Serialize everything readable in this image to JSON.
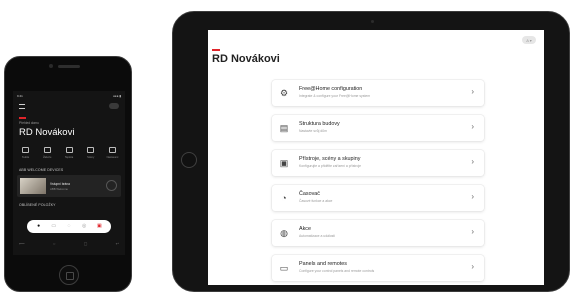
{
  "phone": {
    "status_time": "9:41",
    "status_right": "●●● ▮",
    "subtitle": "Přehled domu",
    "title": "RD Novákovi",
    "quick_actions": [
      {
        "icon": "light-icon",
        "label": "Světla"
      },
      {
        "icon": "blind-icon",
        "label": "Žaluzie"
      },
      {
        "icon": "thermostat-icon",
        "label": "Teplota"
      },
      {
        "icon": "scene-icon",
        "label": "Scény"
      },
      {
        "icon": "gear-icon",
        "label": "Nastavení"
      }
    ],
    "section_recent": "ABB WELCOME DEVICES",
    "card_title": "Vstupní brána",
    "card_subtitle": "ABB Welcome",
    "section_favorites": "OBLÍBENÉ POLOŽKY",
    "navbar": [
      {
        "icon": "home-icon",
        "glyph": "●",
        "state": "active"
      },
      {
        "icon": "devices-icon",
        "glyph": "▭",
        "state": ""
      },
      {
        "icon": "clock-icon",
        "glyph": "◌",
        "state": ""
      },
      {
        "icon": "settings-icon",
        "glyph": "◎",
        "state": ""
      },
      {
        "icon": "alarm-icon",
        "glyph": "▣",
        "state": "accent"
      }
    ],
    "bottom_nav": [
      "⟵",
      "○",
      "▢",
      "↩"
    ]
  },
  "tablet": {
    "avatar_text": "A ▾",
    "title": "RD Novákovi",
    "items": [
      {
        "icon": "gear-icon",
        "glyph": "⚙",
        "title": "Free@Home configuration",
        "subtitle": "Integrate & configure your Free@Home system"
      },
      {
        "icon": "building-icon",
        "glyph": "▤",
        "title": "Struktura budovy",
        "subtitle": "Nastavte svůj dům"
      },
      {
        "icon": "devices-icon",
        "glyph": "▣",
        "title": "Přístroje, scény a skupiny",
        "subtitle": "Konfigurujte a přidělte zařízení a přístroje"
      },
      {
        "icon": "timer-icon",
        "glyph": "◔",
        "title": "Časovač",
        "subtitle": "Časové funkce a akce"
      },
      {
        "icon": "alarm-icon",
        "glyph": "◍",
        "title": "Akce",
        "subtitle": "Automatizace a události"
      },
      {
        "icon": "panel-icon",
        "glyph": "▭",
        "title": "Panels and remotes",
        "subtitle": "Configure your control panels and remote controls"
      }
    ],
    "chevron": "›"
  }
}
